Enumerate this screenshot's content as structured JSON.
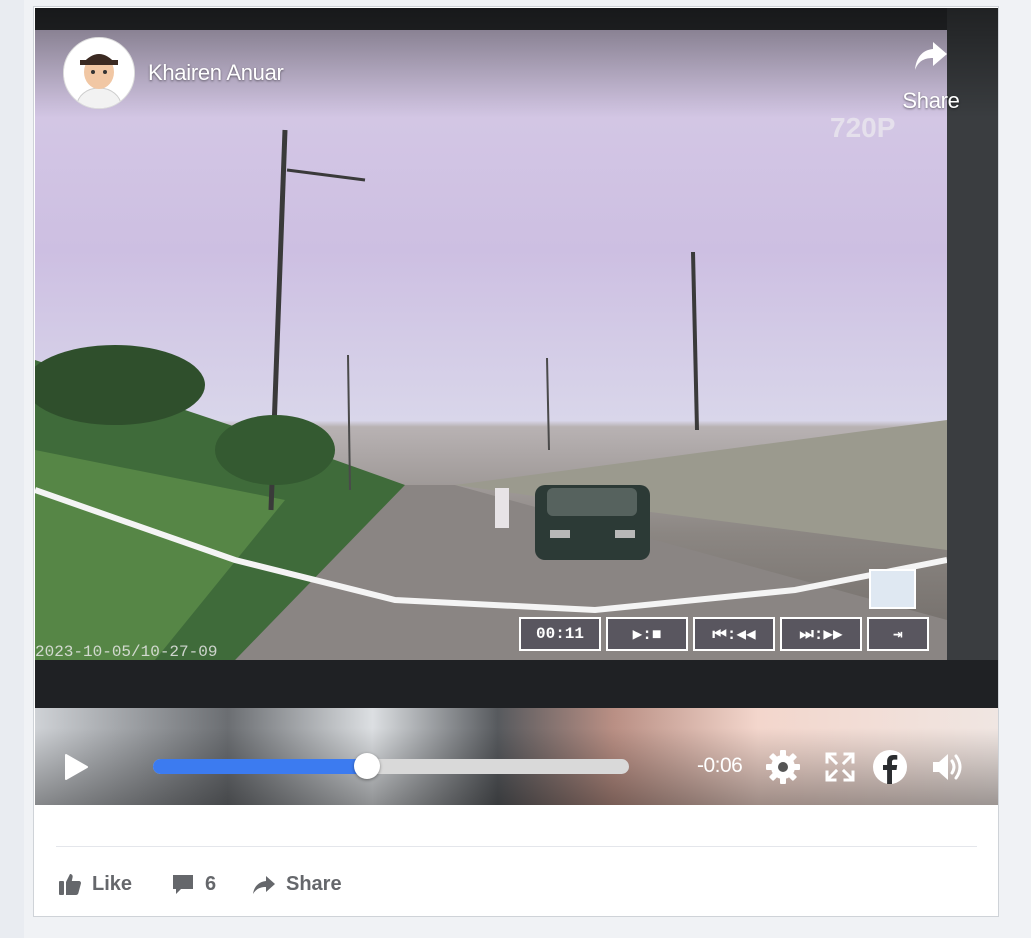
{
  "post": {
    "author": "Khairen Anuar",
    "share_top_label": "Share"
  },
  "video": {
    "dashcam_resolution_text": "720P",
    "dashcam_timestamp_text": "2023-10-05/10-27-09",
    "dashcam_controls": [
      "00:11",
      "▶:■",
      "⏮:◀◀",
      "⏭:▶▶",
      "⇥"
    ],
    "time_remaining": "-0:06",
    "progress_fraction": 0.45
  },
  "actions": {
    "like_label": "Like",
    "comment_count": "6",
    "share_label": "Share"
  },
  "colors": {
    "progress_fill": "#3c7bf0",
    "progress_track": "#d9d9d9",
    "action_text": "#65676b"
  },
  "icons": [
    "play-icon",
    "settings-icon",
    "fullscreen-icon",
    "facebook-icon",
    "volume-icon",
    "share-arrow-icon",
    "like-icon",
    "comment-icon"
  ]
}
